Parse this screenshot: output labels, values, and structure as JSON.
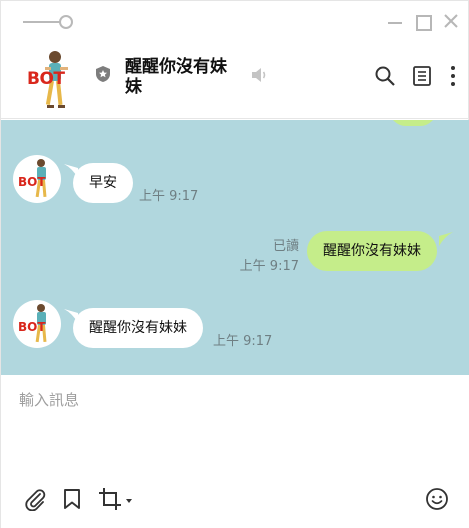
{
  "header": {
    "chat_title": "醒醒你沒有妹妹",
    "avatar_text": "BOT"
  },
  "messages": [
    {
      "direction": "incoming",
      "text": "早安",
      "time": "上午 9:17"
    },
    {
      "direction": "outgoing",
      "text": "醒醒你沒有妹妹",
      "status": "已讀",
      "time": "上午 9:17"
    },
    {
      "direction": "incoming",
      "text": "醒醒你沒有妹妹",
      "time": "上午 9:17"
    }
  ],
  "input": {
    "placeholder": "輸入訊息"
  },
  "colors": {
    "chat_background": "#b1d7de",
    "outgoing_bubble": "#c5ed8a",
    "incoming_bubble": "#ffffff",
    "bot_text": "#d9271c"
  }
}
